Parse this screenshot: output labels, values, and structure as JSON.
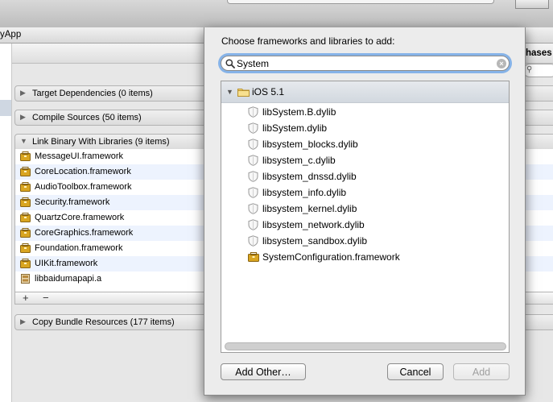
{
  "window": {
    "app_name_partial": "yApp",
    "right_label": "hases"
  },
  "build_phases": [
    {
      "label": "Target Dependencies (0 items)",
      "expanded": false
    },
    {
      "label": "Compile Sources (50 items)",
      "expanded": false
    },
    {
      "label": "Link Binary With Libraries (9 items)",
      "expanded": true
    },
    {
      "label": "Copy Bundle Resources (177 items)",
      "expanded": false
    }
  ],
  "linked_frameworks": [
    {
      "name": "MessageUI.framework",
      "icon": "framework-icon"
    },
    {
      "name": "CoreLocation.framework",
      "icon": "framework-icon"
    },
    {
      "name": "AudioToolbox.framework",
      "icon": "framework-icon"
    },
    {
      "name": "Security.framework",
      "icon": "framework-icon"
    },
    {
      "name": "QuartzCore.framework",
      "icon": "framework-icon"
    },
    {
      "name": "CoreGraphics.framework",
      "icon": "framework-icon"
    },
    {
      "name": "Foundation.framework",
      "icon": "framework-icon"
    },
    {
      "name": "UIKit.framework",
      "icon": "framework-icon"
    },
    {
      "name": "libbaidumapapi.a",
      "icon": "static-library-icon"
    }
  ],
  "phase_controls": {
    "add": "+",
    "remove": "−"
  },
  "sheet": {
    "title": "Choose frameworks and libraries to add:",
    "search_value": "System",
    "group": {
      "label": "iOS 5.1",
      "icon": "folder-icon",
      "expanded": true
    },
    "results": [
      {
        "name": "libSystem.B.dylib",
        "icon": "dylib-shield-icon"
      },
      {
        "name": "libSystem.dylib",
        "icon": "dylib-shield-icon"
      },
      {
        "name": "libsystem_blocks.dylib",
        "icon": "dylib-shield-icon"
      },
      {
        "name": "libsystem_c.dylib",
        "icon": "dylib-shield-icon"
      },
      {
        "name": "libsystem_dnssd.dylib",
        "icon": "dylib-shield-icon"
      },
      {
        "name": "libsystem_info.dylib",
        "icon": "dylib-shield-icon"
      },
      {
        "name": "libsystem_kernel.dylib",
        "icon": "dylib-shield-icon"
      },
      {
        "name": "libsystem_network.dylib",
        "icon": "dylib-shield-icon"
      },
      {
        "name": "libsystem_sandbox.dylib",
        "icon": "dylib-shield-icon"
      },
      {
        "name": "SystemConfiguration.framework",
        "icon": "framework-icon"
      }
    ],
    "buttons": {
      "add_other": "Add Other…",
      "cancel": "Cancel",
      "add": "Add"
    }
  },
  "colors": {
    "focus_ring": "#86b3e8",
    "row_stripe": "#edf3fe",
    "framework_gold": "#d9a520"
  }
}
